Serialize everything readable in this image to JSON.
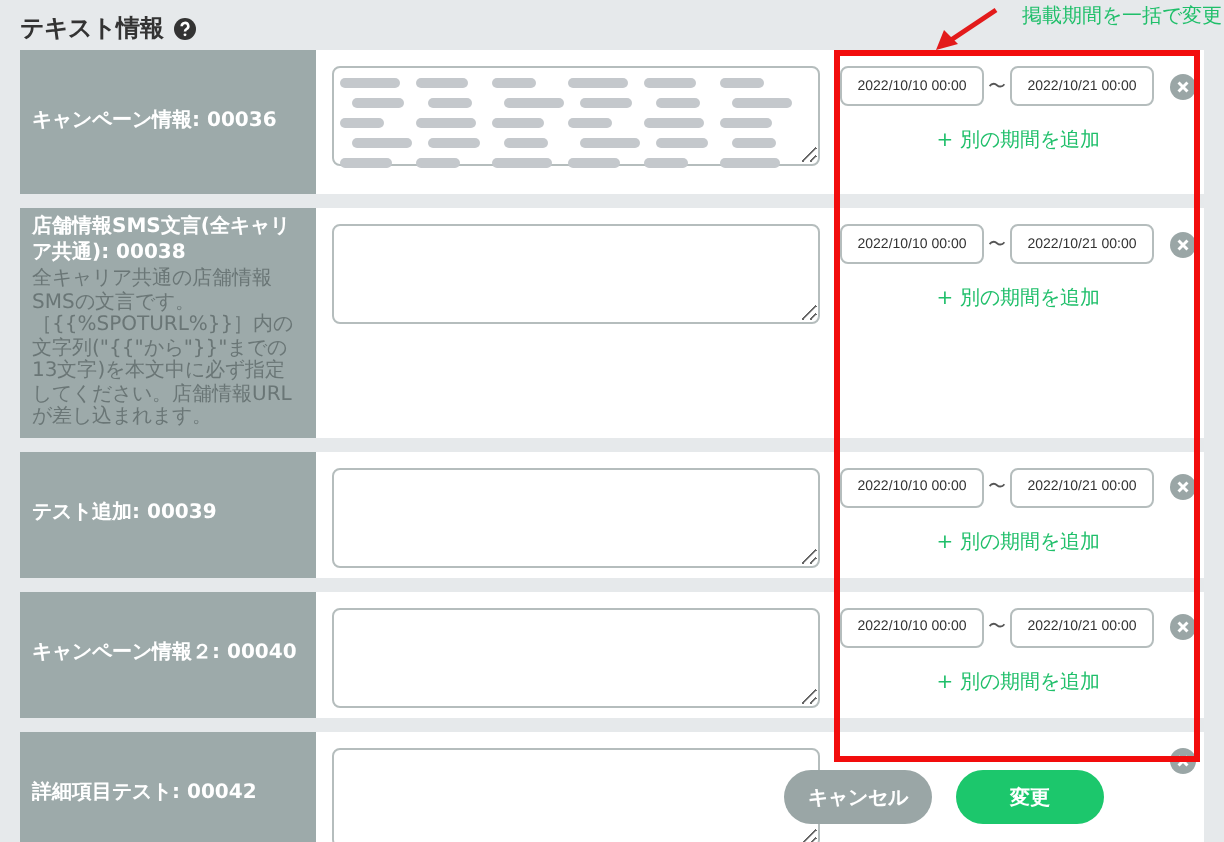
{
  "section": {
    "title": "テキスト情報"
  },
  "annotation": {
    "text": "掲載期間を一括で変更"
  },
  "fields": [
    {
      "label": "キャンペーン情報: 00036",
      "blurred": true,
      "start": "2022/10/10 00:00",
      "separator": "〜",
      "end": "2022/10/21 00:00",
      "add_link": "+ 別の期間を追加"
    },
    {
      "label": "店舗情報SMS文言(全キャリア共通): 00038",
      "description": "全キャリア共通の店舗情報SMSの文言です。［{{%SPOTURL%}}］内の文字列(\"{{\"から\"}}\"までの13文字)を本文中に必ず指定してください。店舗情報URLが差し込まれます。",
      "blurred": false,
      "start": "2022/10/10 00:00",
      "separator": "〜",
      "end": "2022/10/21 00:00",
      "add_link": "+ 別の期間を追加"
    },
    {
      "label": "テスト追加: 00039",
      "blurred": false,
      "start": "2022/10/10 00:00",
      "separator": "〜",
      "end": "2022/10/21 00:00",
      "add_link": "+ 別の期間を追加"
    },
    {
      "label": "キャンペーン情報２: 00040",
      "blurred": false,
      "start": "2022/10/10 00:00",
      "separator": "〜",
      "end": "2022/10/21 00:00",
      "add_link": "+ 別の期間を追加"
    },
    {
      "label": "詳細項目テスト: 00042",
      "blurred": false
    }
  ],
  "buttons": [
    {
      "label": "キャンセル",
      "kind": "secondary"
    },
    {
      "label": "変更",
      "kind": "primary"
    }
  ]
}
